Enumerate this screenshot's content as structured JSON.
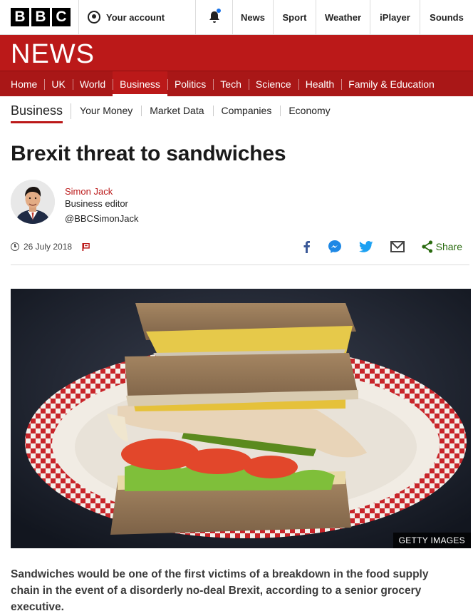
{
  "topbar": {
    "logo_letters": [
      "B",
      "B",
      "C"
    ],
    "account_label": "Your account",
    "notification_dot_color": "#1a73e8",
    "links": [
      "News",
      "Sport",
      "Weather",
      "iPlayer",
      "Sounds"
    ]
  },
  "banner": {
    "title": "NEWS",
    "color": "#bb1919"
  },
  "nav": {
    "items": [
      "Home",
      "UK",
      "World",
      "Business",
      "Politics",
      "Tech",
      "Science",
      "Health",
      "Family & Education"
    ],
    "active": "Business"
  },
  "subnav": {
    "title": "Business",
    "items": [
      "Your Money",
      "Market Data",
      "Companies",
      "Economy"
    ]
  },
  "article": {
    "headline": "Brexit threat to sandwiches",
    "author": {
      "name": "Simon Jack",
      "role": "Business editor",
      "handle": "@BBCSimonJack"
    },
    "date": "26 July 2018",
    "share": {
      "icons": [
        "facebook-icon",
        "messenger-icon",
        "twitter-icon",
        "email-icon",
        "share-icon"
      ],
      "label": "Share"
    },
    "image_credit": "GETTY IMAGES",
    "intro": "Sandwiches would be one of the first victims of a breakdown in the food supply chain in the event of a disorderly no-deal Brexit, according to a senior grocery executive."
  }
}
